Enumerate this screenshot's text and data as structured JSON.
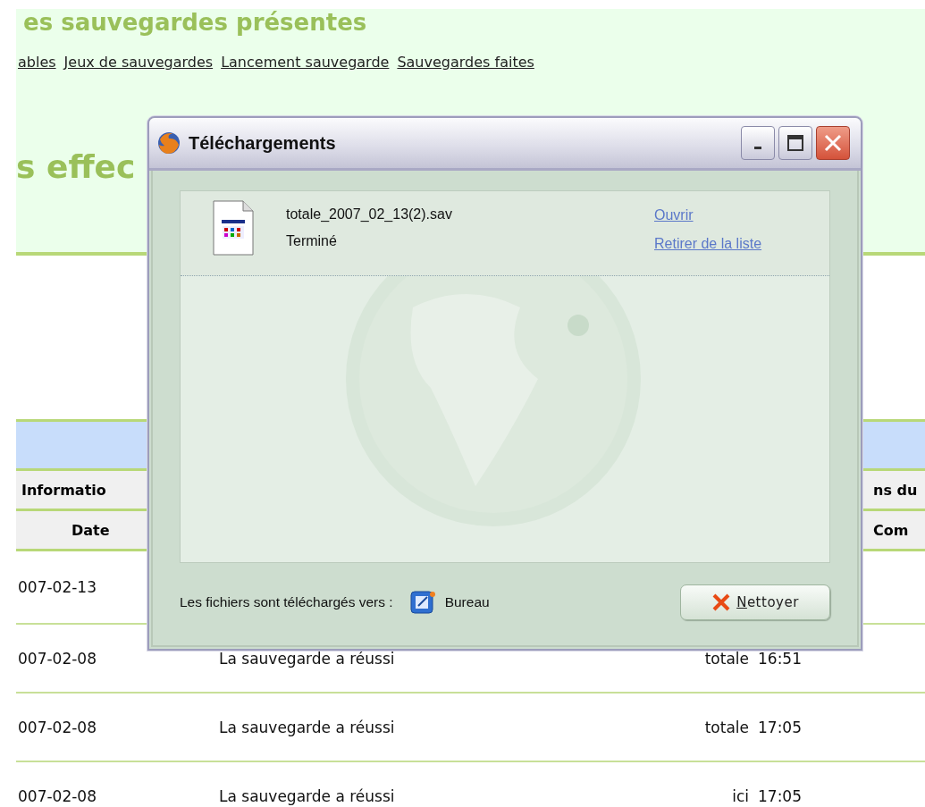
{
  "page": {
    "title": "es sauvegardes présentes",
    "nav_links": [
      "ables",
      "Jeux de sauvegardes",
      "Lancement sauvegarde",
      "Sauvegardes faites"
    ],
    "section_title": "s effec",
    "table": {
      "header_rows": [
        [
          "Informatio",
          "ns du"
        ],
        [
          "Date",
          "Com"
        ]
      ],
      "rows": [
        {
          "date": "007-02-13"
        },
        {
          "date": "007-02-08",
          "message": "La sauvegarde a réussi",
          "type": "totale",
          "time": "16:51"
        },
        {
          "date": "007-02-08",
          "message": "La sauvegarde a réussi",
          "type": "totale",
          "time": "17:05"
        },
        {
          "date": "007-02-08",
          "message": "La sauvegarde a réussi",
          "type": "ici",
          "time": "17:05"
        }
      ]
    }
  },
  "dialog": {
    "title": "Téléchargements",
    "downloads": [
      {
        "file_name": "totale_2007_02_13(2).sav",
        "status": "Terminé",
        "actions": [
          "Ouvrir",
          "Retirer de la liste"
        ]
      }
    ],
    "footer": {
      "label": "Les fichiers sont téléchargés vers :",
      "folder": "Bureau",
      "button": "Nettoyer"
    }
  }
}
